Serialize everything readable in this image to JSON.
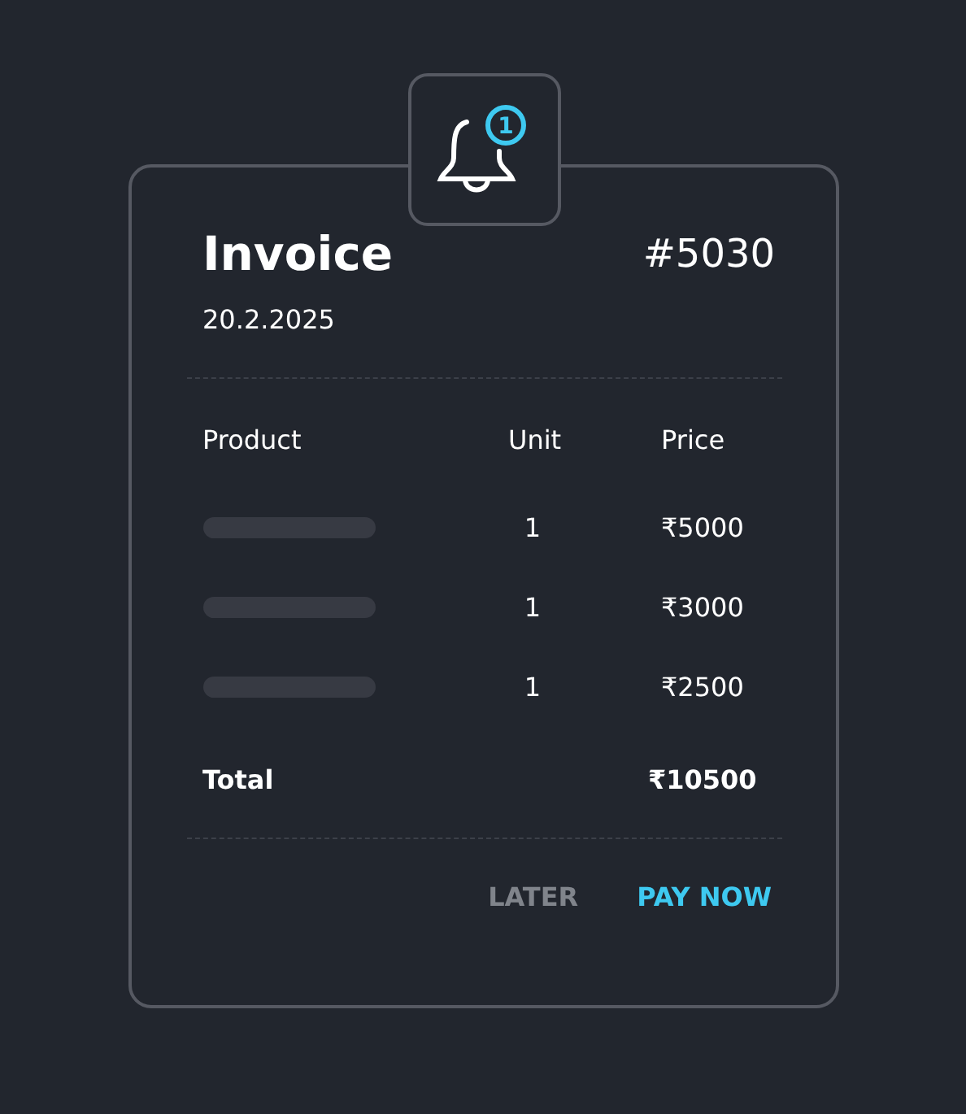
{
  "badge_count": "1",
  "invoice": {
    "title": "Invoice",
    "number": "#5030",
    "date": "20.2.2025"
  },
  "table": {
    "columns": [
      "Product",
      "Unit",
      "Price"
    ],
    "rows": [
      {
        "unit": "1",
        "price": "₹5000"
      },
      {
        "unit": "1",
        "price": "₹3000"
      },
      {
        "unit": "1",
        "price": "₹2500"
      }
    ],
    "total_label": "Total",
    "total": "₹10500"
  },
  "buttons": [
    {
      "label": "LATER",
      "kind": "secondary"
    },
    {
      "label": "PAY NOW",
      "kind": "primary"
    }
  ]
}
